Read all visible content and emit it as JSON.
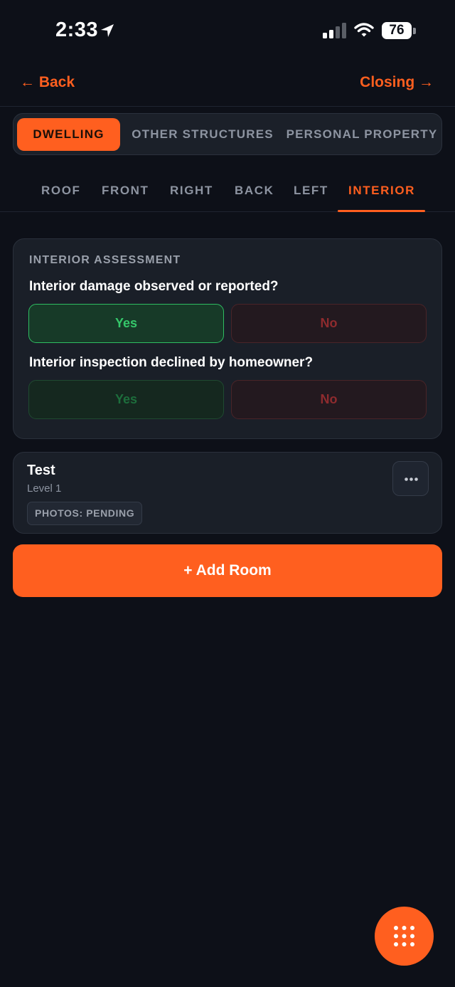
{
  "status_bar": {
    "time": "2:33",
    "battery": "76",
    "icons": [
      "location-arrow-icon",
      "signal-icon",
      "wifi-icon",
      "battery-icon"
    ]
  },
  "header": {
    "back_label": "← Back",
    "next_label": "Closing →"
  },
  "segments": {
    "items": [
      {
        "label": "DWELLING",
        "active": true
      },
      {
        "label": "OTHER STRUCTURES",
        "active": false
      },
      {
        "label": "PERSONAL PROPERTY",
        "active": false
      }
    ]
  },
  "tabs": {
    "items": [
      {
        "label": "ROOF",
        "active": false
      },
      {
        "label": "FRONT",
        "active": false
      },
      {
        "label": "RIGHT",
        "active": false
      },
      {
        "label": "BACK",
        "active": false
      },
      {
        "label": "LEFT",
        "active": false
      },
      {
        "label": "INTERIOR",
        "active": true
      }
    ]
  },
  "assessment": {
    "title": "INTERIOR ASSESSMENT",
    "questions": [
      {
        "text": "Interior damage observed or reported?",
        "yes": "Yes",
        "no": "No",
        "selected": "Yes"
      },
      {
        "text": "Interior inspection declined by homeowner?",
        "yes": "Yes",
        "no": "No",
        "selected": ""
      }
    ]
  },
  "rooms": [
    {
      "name": "Test",
      "level": "Level 1",
      "badge": "PHOTOS: PENDING"
    }
  ],
  "actions": {
    "add_room": "+ Add Room"
  },
  "colors": {
    "accent": "#ff5f1f",
    "background": "#0d1018",
    "card": "#1a1f28",
    "yes_green": "#35c76a",
    "no_red": "#8e2b2e"
  }
}
